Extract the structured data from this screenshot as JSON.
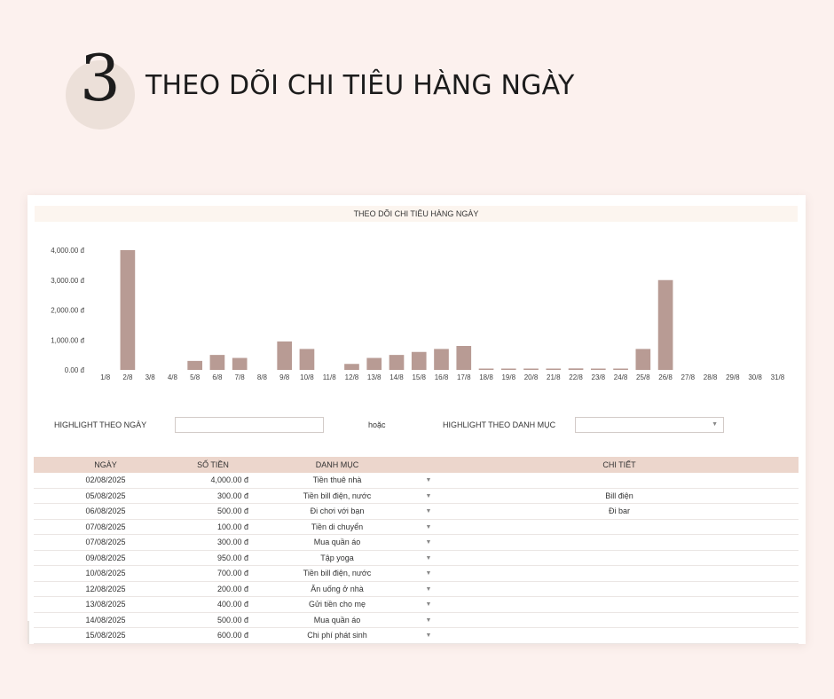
{
  "header": {
    "step_number": "3",
    "title": "THEO DÕI CHI TIÊU HÀNG NGÀY"
  },
  "colors": {
    "background": "#fcf1ee",
    "bar": "#b89b94",
    "table_header": "#ecd6cc",
    "step_circle": "#ece0d9"
  },
  "chart_data": {
    "type": "bar",
    "title": "THEO DÕI CHI TIÊU HÀNG NGÀY",
    "categories": [
      "1/8",
      "2/8",
      "3/8",
      "4/8",
      "5/8",
      "6/8",
      "7/8",
      "8/8",
      "9/8",
      "10/8",
      "11/8",
      "12/8",
      "13/8",
      "14/8",
      "15/8",
      "16/8",
      "17/8",
      "18/8",
      "19/8",
      "20/8",
      "21/8",
      "22/8",
      "23/8",
      "24/8",
      "25/8",
      "26/8",
      "27/8",
      "28/8",
      "29/8",
      "30/8",
      "31/8"
    ],
    "values": [
      0,
      4000,
      0,
      0,
      300,
      500,
      400,
      0,
      950,
      700,
      0,
      200,
      400,
      500,
      600,
      700,
      800,
      20,
      20,
      20,
      20,
      50,
      20,
      20,
      700,
      3000,
      0,
      0,
      0,
      0,
      0
    ],
    "y_ticks": [
      "4,000.00 đ",
      "3,000.00 đ",
      "2,000.00 đ",
      "1,000.00 đ",
      "0.00 đ"
    ],
    "ylim": [
      0,
      4000
    ],
    "grid": false,
    "legend": "none"
  },
  "filters": {
    "by_date_label": "HIGHLIGHT THEO NGÀY",
    "or_label": "hoặc",
    "by_category_label": "HIGHLIGHT THEO DANH MỤC"
  },
  "table": {
    "columns": [
      "NGÀY",
      "SỐ TIỀN",
      "DANH MỤC",
      "CHI TIẾT"
    ],
    "rows": [
      {
        "date": "02/08/2025",
        "amount": "4,000.00 đ",
        "category": "Tiền thuê nhà",
        "detail": ""
      },
      {
        "date": "05/08/2025",
        "amount": "300.00 đ",
        "category": "Tiền bill điện, nước",
        "detail": "Bill điện"
      },
      {
        "date": "06/08/2025",
        "amount": "500.00 đ",
        "category": "Đi chơi với bạn",
        "detail": "Đi bar"
      },
      {
        "date": "07/08/2025",
        "amount": "100.00 đ",
        "category": "Tiền di chuyển",
        "detail": ""
      },
      {
        "date": "07/08/2025",
        "amount": "300.00 đ",
        "category": "Mua quần áo",
        "detail": ""
      },
      {
        "date": "09/08/2025",
        "amount": "950.00 đ",
        "category": "Tập yoga",
        "detail": ""
      },
      {
        "date": "10/08/2025",
        "amount": "700.00 đ",
        "category": "Tiền bill điện, nước",
        "detail": ""
      },
      {
        "date": "12/08/2025",
        "amount": "200.00 đ",
        "category": "Ăn uống ở nhà",
        "detail": ""
      },
      {
        "date": "13/08/2025",
        "amount": "400.00 đ",
        "category": "Gửi tiền cho mẹ",
        "detail": ""
      },
      {
        "date": "14/08/2025",
        "amount": "500.00 đ",
        "category": "Mua quần áo",
        "detail": ""
      },
      {
        "date": "15/08/2025",
        "amount": "600.00 đ",
        "category": "Chi phí phát sinh",
        "detail": ""
      }
    ]
  }
}
